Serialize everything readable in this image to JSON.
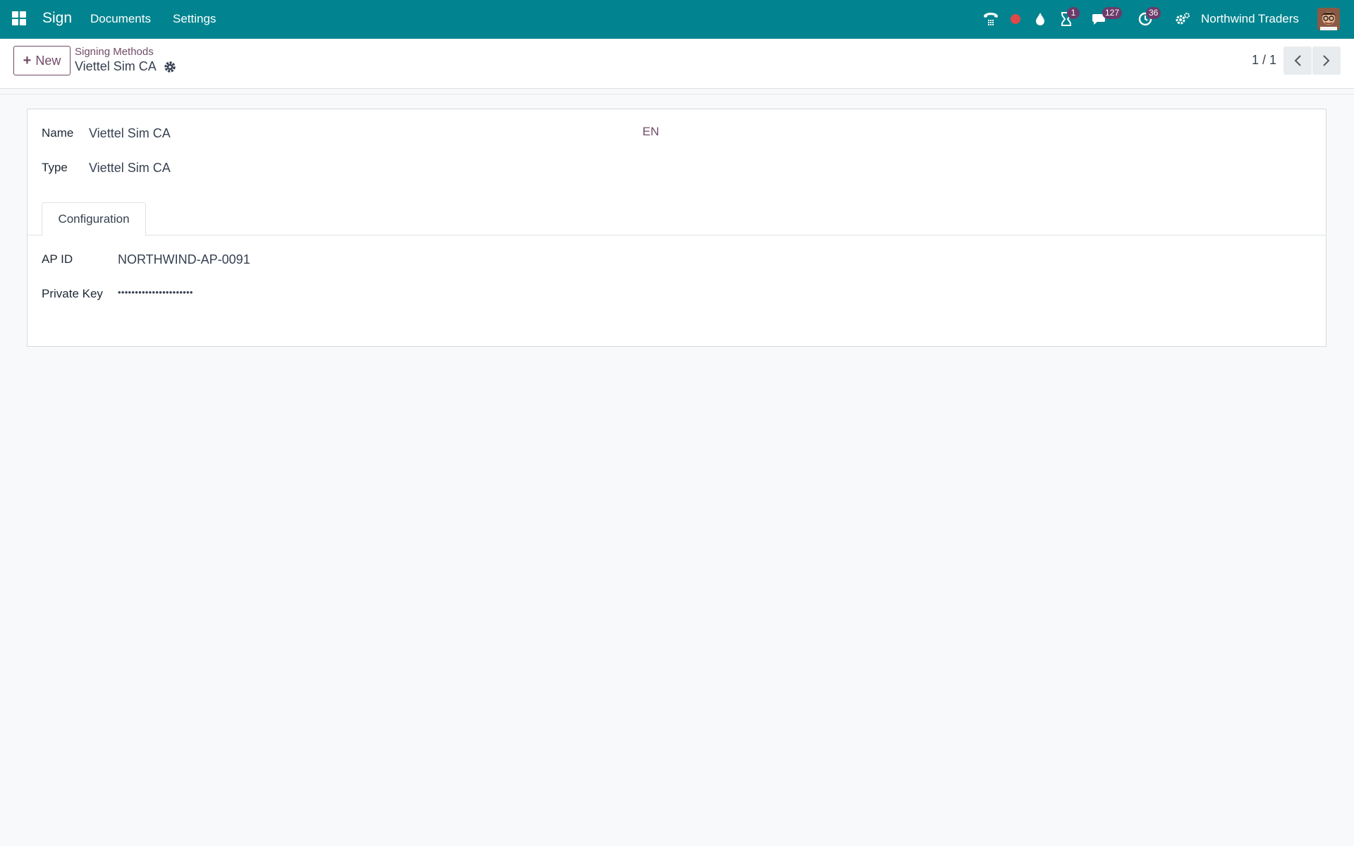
{
  "navbar": {
    "app_name": "Sign",
    "menu": [
      "Documents",
      "Settings"
    ],
    "badges": {
      "activities": "1",
      "messages": "127",
      "clock": "36"
    },
    "company": "Northwind Traders",
    "bg_color": "#01848f"
  },
  "control_panel": {
    "new_label": "New",
    "breadcrumb_parent": "Signing Methods",
    "breadcrumb_current": "Viettel Sim CA",
    "pager": "1 / 1"
  },
  "form": {
    "name_label": "Name",
    "name_value": "Viettel Sim CA",
    "lang": "EN",
    "type_label": "Type",
    "type_value": "Viettel Sim CA",
    "tab_label": "Configuration",
    "ap_id_label": "AP ID",
    "ap_id_value": "NORTHWIND-AP-0091",
    "private_key_label": "Private Key",
    "private_key_value": "••••••••••••••••••••••"
  },
  "colors": {
    "accent": "#714b67",
    "navbar": "#01848f",
    "badge": "#6b3b6a"
  }
}
